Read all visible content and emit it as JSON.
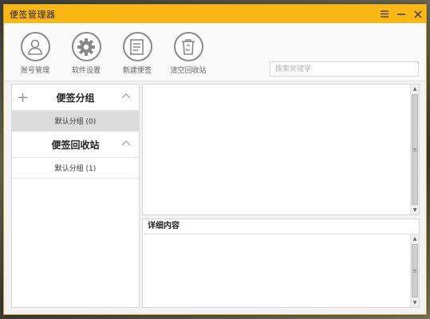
{
  "window": {
    "title": "便签管理器",
    "controls": {
      "menu_icon": "menu-icon",
      "minimize_icon": "minimize-icon",
      "close_icon": "close-icon"
    }
  },
  "toolbar": {
    "items": [
      {
        "label": "账号管理",
        "icon": "user-icon"
      },
      {
        "label": "软件设置",
        "icon": "gear-icon"
      },
      {
        "label": "新建便签",
        "icon": "note-icon"
      },
      {
        "label": "清空回收站",
        "icon": "recycle-bin-icon"
      }
    ]
  },
  "search": {
    "placeholder": "搜索关键字",
    "value": ""
  },
  "sidebar": {
    "groups": [
      {
        "title": "便签分组",
        "items": [
          {
            "label": "默认分组 (0)",
            "selected": true
          }
        ]
      },
      {
        "title": "便签回收站",
        "items": [
          {
            "label": "默认分组 (1)",
            "selected": false
          }
        ]
      }
    ]
  },
  "detail": {
    "header": "详细内容",
    "content": ""
  },
  "colors": {
    "titlebar": "#fbb814",
    "selected_item": "#dcdcdc",
    "panel_bg": "#ffffff",
    "window_bg": "#f3f3f3"
  }
}
